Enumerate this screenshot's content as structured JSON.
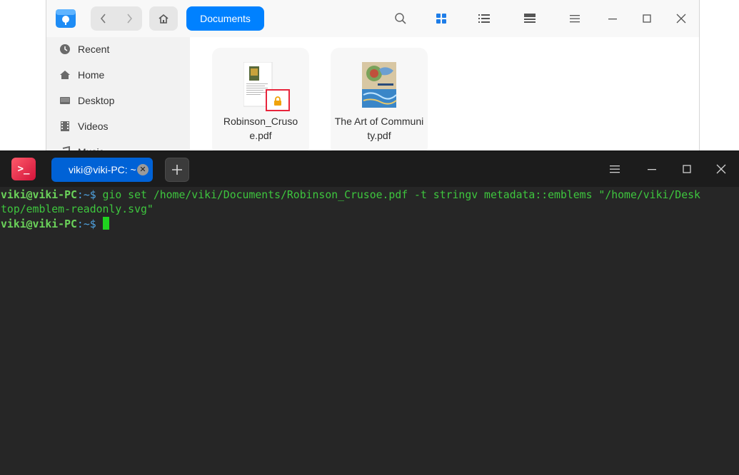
{
  "file_manager": {
    "breadcrumb": "Documents",
    "sidebar": [
      {
        "label": "Recent",
        "icon": "clock-icon"
      },
      {
        "label": "Home",
        "icon": "home-icon"
      },
      {
        "label": "Desktop",
        "icon": "desktop-icon"
      },
      {
        "label": "Videos",
        "icon": "film-icon"
      },
      {
        "label": "Music",
        "icon": "music-icon"
      }
    ],
    "files": [
      {
        "name": "Robinson_Cruso\ne.pdf",
        "emblem": "lock-icon"
      },
      {
        "name": "The Art of Community.pdf"
      }
    ]
  },
  "terminal": {
    "tab_label": "viki@viki-PC: ~",
    "lines": [
      {
        "user": "viki@viki-PC",
        "sep": ":~$ ",
        "cmd": "gio set /home/viki/Documents/Robinson_Crusoe.pdf -t stringv metadata::emblems \"/home/viki/Desk\ntop/emblem-readonly.svg\""
      },
      {
        "user": "viki@viki-PC",
        "sep": ":~$ ",
        "cmd": ""
      }
    ]
  },
  "colors": {
    "accent": "#0081ff",
    "terminal_bg": "#262626",
    "prompt_green": "#6bd35a",
    "emblem_border": "#e8253c",
    "lock_color": "#f0a30a"
  }
}
